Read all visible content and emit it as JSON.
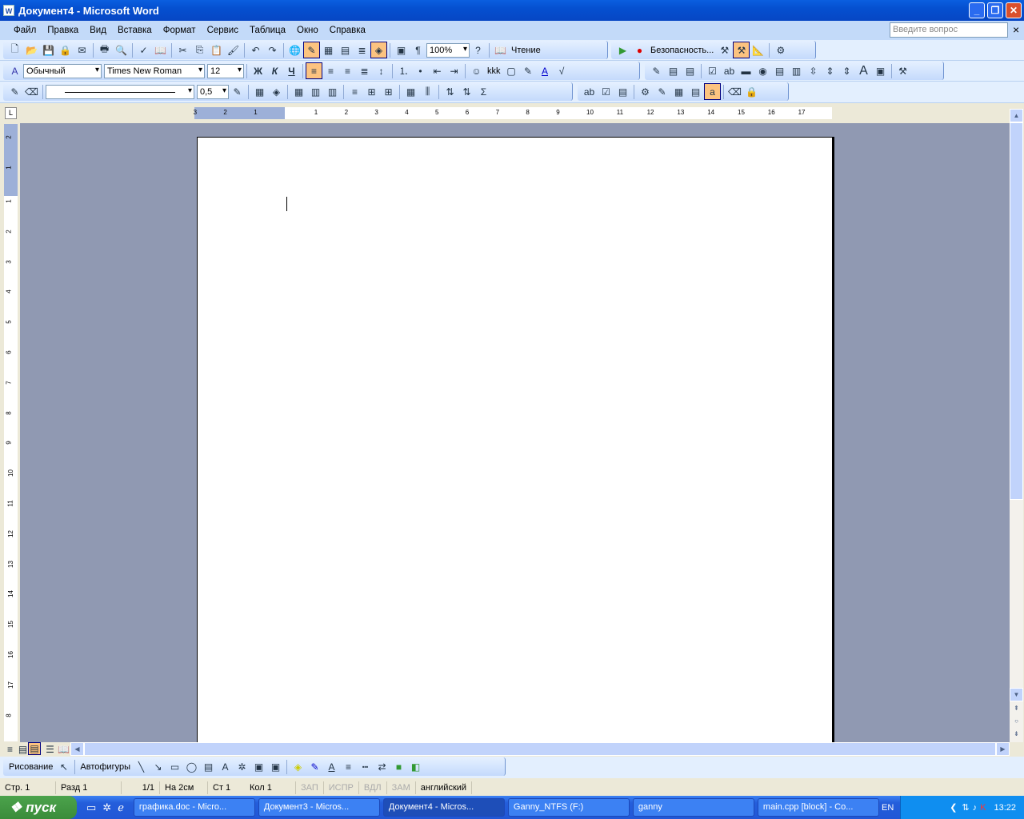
{
  "window": {
    "title": "Документ4 - Microsoft Word",
    "app_icon": "word-icon",
    "minimize": "_",
    "restore": "❐",
    "close": "✕"
  },
  "menu": [
    "Файл",
    "Правка",
    "Вид",
    "Вставка",
    "Формат",
    "Сервис",
    "Таблица",
    "Окно",
    "Справка"
  ],
  "help_box": {
    "placeholder": "Введите вопрос",
    "close": "×"
  },
  "standard_toolbar": {
    "icons": [
      "new",
      "open",
      "save",
      "permission",
      "print-preview-email",
      "print",
      "print-preview",
      "spelling",
      "research",
      "cut",
      "copy",
      "paste",
      "format-painter",
      "undo",
      "redo",
      "hyperlink",
      "tables-borders",
      "insert-table",
      "insert-excel",
      "columns",
      "drawing",
      "document-map",
      "show-formatting"
    ],
    "zoom": "100%",
    "reading": "Чтение"
  },
  "security_toolbar": {
    "security": "Безопасность..."
  },
  "formatting_toolbar": {
    "style": "Обычный",
    "font": "Times New Roman",
    "size": "12",
    "bold": "Ж",
    "italic": "К",
    "underline": "Ч",
    "kkk": "kkk"
  },
  "tables_toolbar": {
    "line_weight": "0,5"
  },
  "ruler": {
    "h_ticks": [
      "3",
      "2",
      "1",
      "1",
      "2",
      "3",
      "4",
      "5",
      "6",
      "7",
      "8",
      "9",
      "10",
      "11",
      "12",
      "13",
      "14",
      "15",
      "16",
      "17"
    ],
    "v_ticks": [
      "2",
      "1",
      "1",
      "2",
      "3",
      "4",
      "5",
      "6",
      "7",
      "8",
      "9",
      "10",
      "11",
      "12",
      "13",
      "14",
      "15",
      "16",
      "17",
      "8"
    ],
    "tab_selector": "L"
  },
  "drawing_toolbar": {
    "drawing": "Рисование",
    "autoshapes": "Автофигуры"
  },
  "status": {
    "page": "Стр. 1",
    "section": "Разд 1",
    "pages": "1/1",
    "at": "На 2см",
    "line": "Ст 1",
    "col": "Кол 1",
    "rec": "ЗАП",
    "trk": "ИСПР",
    "ext": "ВДЛ",
    "ovr": "ЗАМ",
    "lang": "английский"
  },
  "taskbar": {
    "start": "пуск",
    "tasks": [
      "графика.doc - Micro...",
      "Документ3 - Micros...",
      "Документ4 - Micros...",
      "Ganny_NTFS (F:)",
      "ganny",
      "main.cpp [block] - Co..."
    ],
    "lang": "EN",
    "clock": "13:22"
  }
}
